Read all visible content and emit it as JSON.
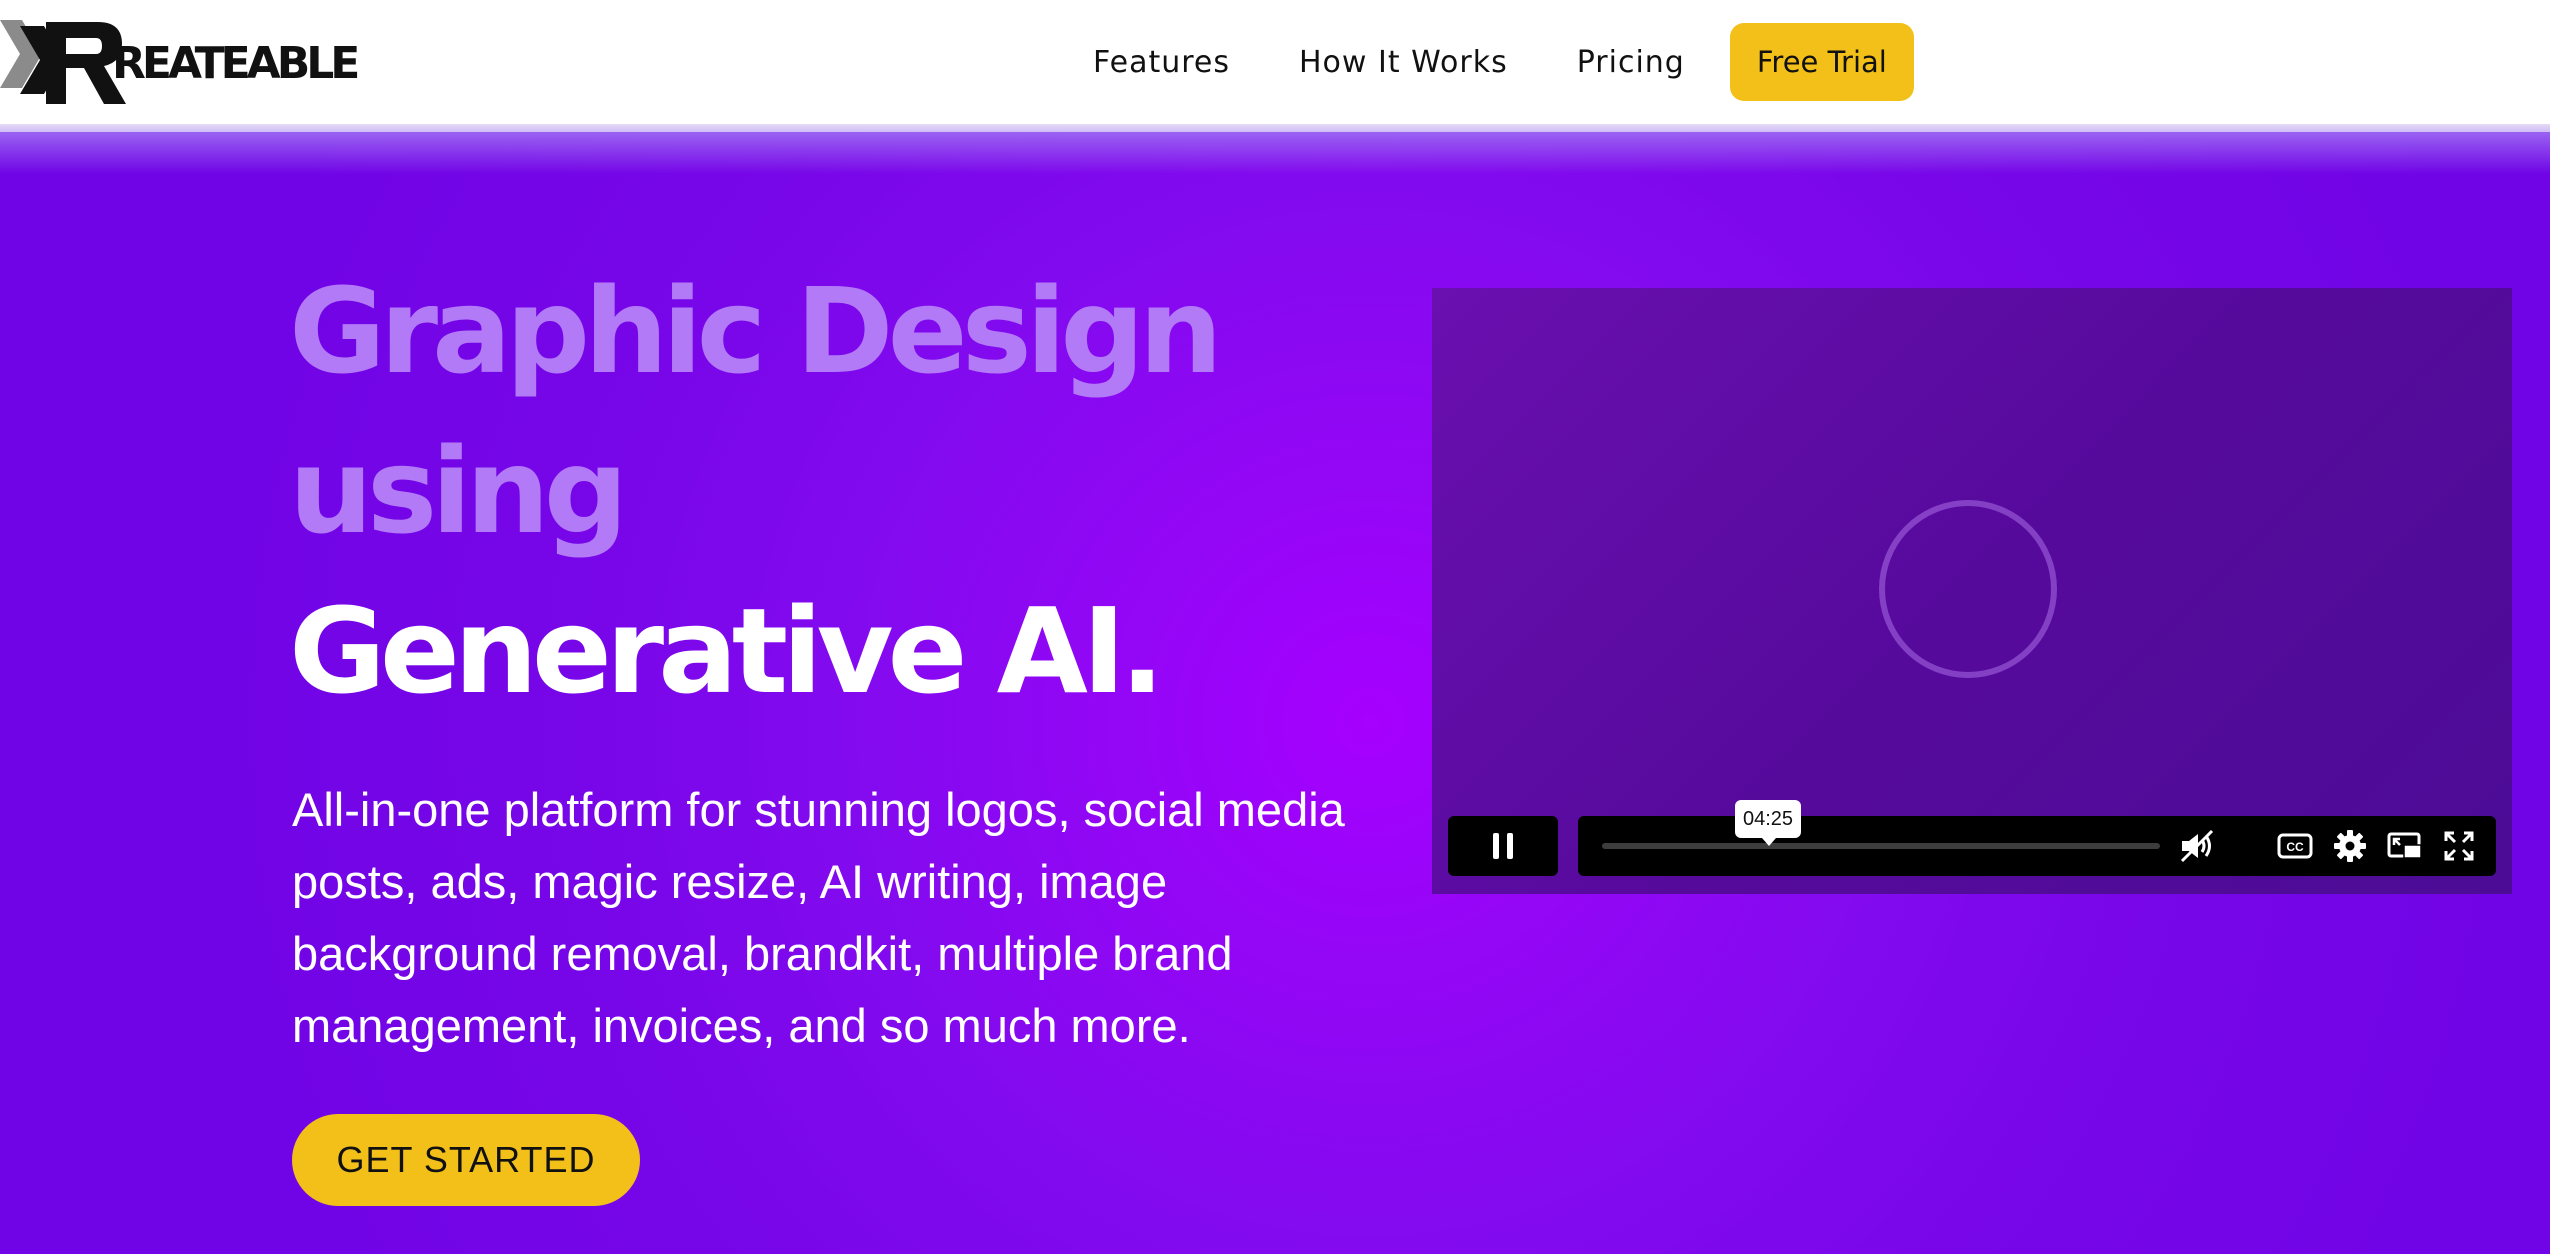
{
  "header": {
    "logo_text": "REATEABLE",
    "nav": [
      "Features",
      "How It Works",
      "Pricing"
    ],
    "cta_label": "Free Trial"
  },
  "hero": {
    "headline_line1": "Graphic Design",
    "headline_line2": "using",
    "headline_line3": "Generative AI.",
    "description": "All-in-one platform for stunning logos, social media posts, ads, magic resize, AI writing, image background removal, brandkit, multiple brand management, invoices, and so much more.",
    "cta_label": "GET STARTED"
  },
  "video": {
    "time_tooltip": "04:25",
    "icons": [
      "pause-icon",
      "mute-icon",
      "captions-icon",
      "settings-icon",
      "picture-in-picture-icon",
      "fullscreen-icon"
    ]
  },
  "colors": {
    "accent_yellow": "#f2c019",
    "hero_purple": "#7706e8",
    "headline_light": "#b27af7"
  }
}
